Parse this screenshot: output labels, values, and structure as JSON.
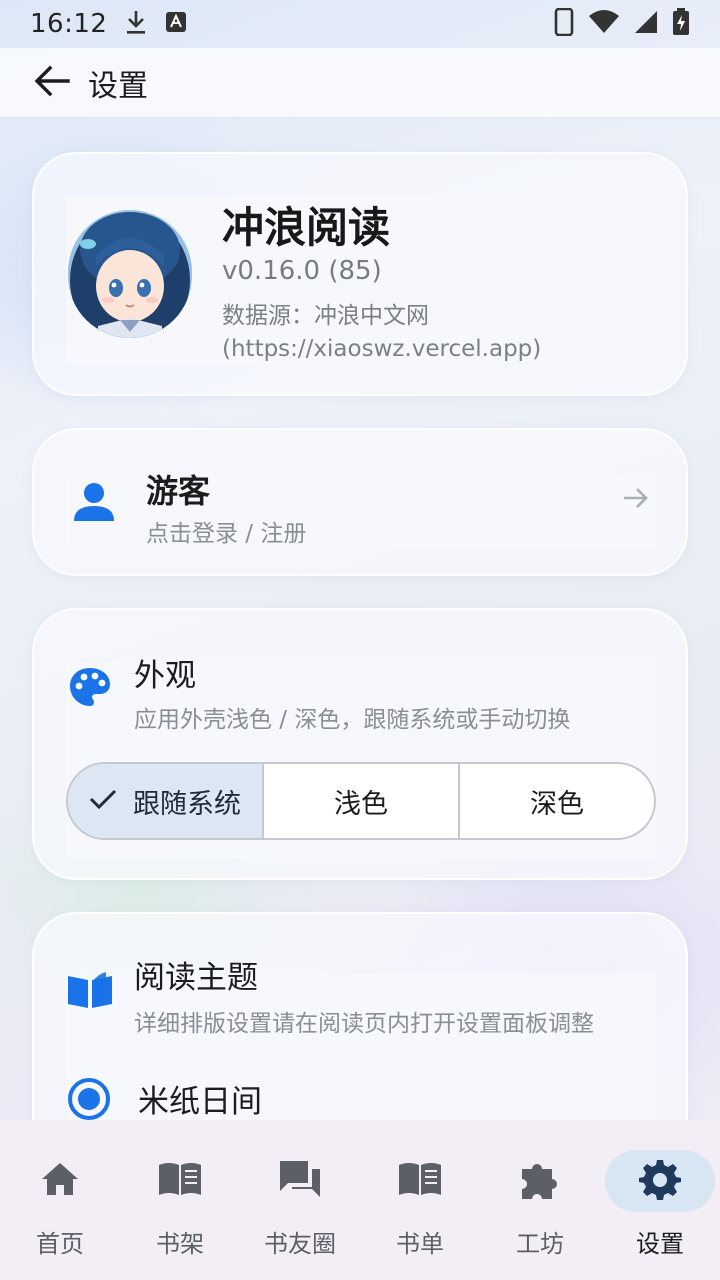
{
  "status_bar": {
    "time": "16:12",
    "icons_left": [
      "download-icon",
      "keyboard-a-icon"
    ],
    "icons_right": [
      "phone-icon",
      "wifi-icon",
      "signal-icon",
      "battery-charging-icon"
    ]
  },
  "app_bar": {
    "title": "设置",
    "back_icon": "arrow-left-icon"
  },
  "profile": {
    "app_name": "冲浪阅读",
    "version": "v0.16.0 (85)",
    "data_source": "数据源：冲浪中文网 (https://xiaoswz.vercel.app)"
  },
  "account": {
    "name": "游客",
    "subtitle": "点击登录 / 注册",
    "icon": "person-icon",
    "arrow_icon": "arrow-right-icon"
  },
  "appearance": {
    "title": "外观",
    "subtitle": "应用外壳浅色 / 深色，跟随系统或手动切换",
    "icon": "palette-icon",
    "options": [
      "跟随系统",
      "浅色",
      "深色"
    ],
    "selected": "跟随系统"
  },
  "reading_theme": {
    "title": "阅读主题",
    "subtitle": "详细排版设置请在阅读页内打开设置面板调整",
    "icon": "open-book-icon",
    "options": [
      {
        "label": "米纸日间",
        "selected": true
      }
    ]
  },
  "bottom_nav": {
    "items": [
      {
        "label": "首页",
        "icon": "home-icon"
      },
      {
        "label": "书架",
        "icon": "book-icon"
      },
      {
        "label": "书友圈",
        "icon": "forum-icon"
      },
      {
        "label": "书单",
        "icon": "book-list-icon"
      },
      {
        "label": "工坊",
        "icon": "puzzle-icon"
      },
      {
        "label": "设置",
        "icon": "gear-icon"
      }
    ],
    "active": "设置"
  },
  "colors": {
    "accent": "#1a73e8",
    "nav_active_bg": "#d8e5f3",
    "segment_selected_bg": "#dde7f4"
  }
}
